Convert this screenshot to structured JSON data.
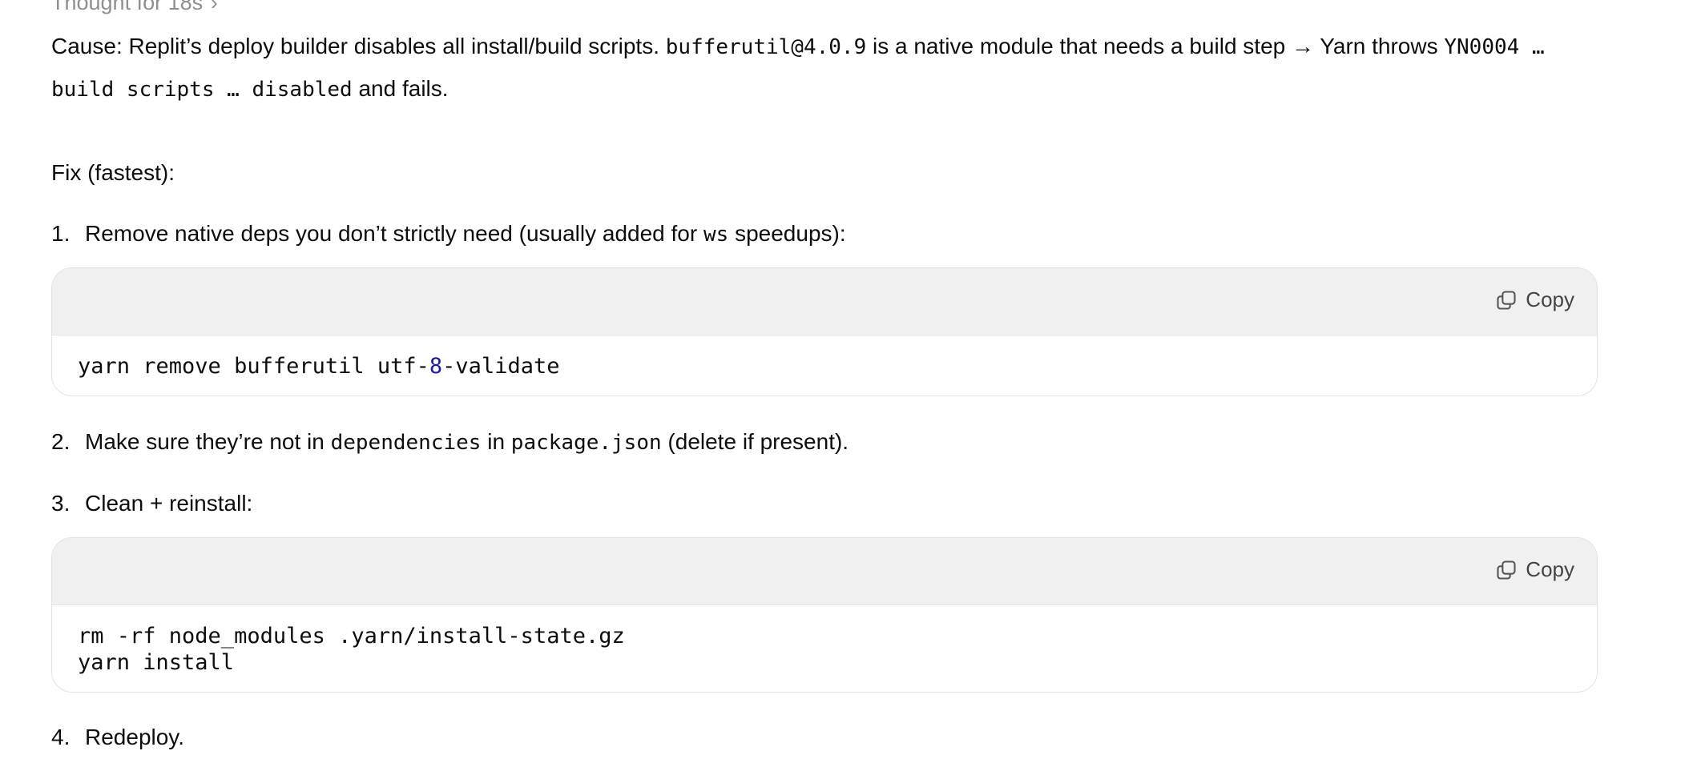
{
  "thought": {
    "label": "Thought for 18s",
    "chevron": "›"
  },
  "cause": {
    "text1": "Cause: Replit’s deploy builder disables all install/build scripts. ",
    "code1": "bufferutil@4.0.9",
    "text2": " is a native module that needs a build step → Yarn throws ",
    "code2": "YN0004 … build scripts … disabled",
    "text3": " and fails."
  },
  "fix_heading": "Fix (fastest):",
  "steps": [
    {
      "num": "1.",
      "text1": "Remove native deps you don’t strictly need (usually added for ",
      "code1": "ws",
      "text2": " speedups):"
    },
    {
      "num": "2.",
      "text1": "Make sure they’re not in ",
      "code1": "dependencies",
      "text2": " in ",
      "code2": "package.json",
      "text3": " (delete if present)."
    },
    {
      "num": "3.",
      "text1": "Clean + reinstall:"
    },
    {
      "num": "4.",
      "text1": "Redeploy."
    }
  ],
  "code_blocks": [
    {
      "copy_label": "Copy",
      "line1_a": "yarn remove bufferutil utf-",
      "line1_num": "8",
      "line1_b": "-validate"
    },
    {
      "copy_label": "Copy",
      "line1": "rm -rf node_modules .yarn/install-state.gz",
      "line2": "yarn install"
    }
  ],
  "colors": {
    "code_header_bg": "#f0f0f0",
    "border": "#e3e3e3",
    "number_token": "#1a1aa6",
    "muted_text": "#8f8f8f"
  }
}
